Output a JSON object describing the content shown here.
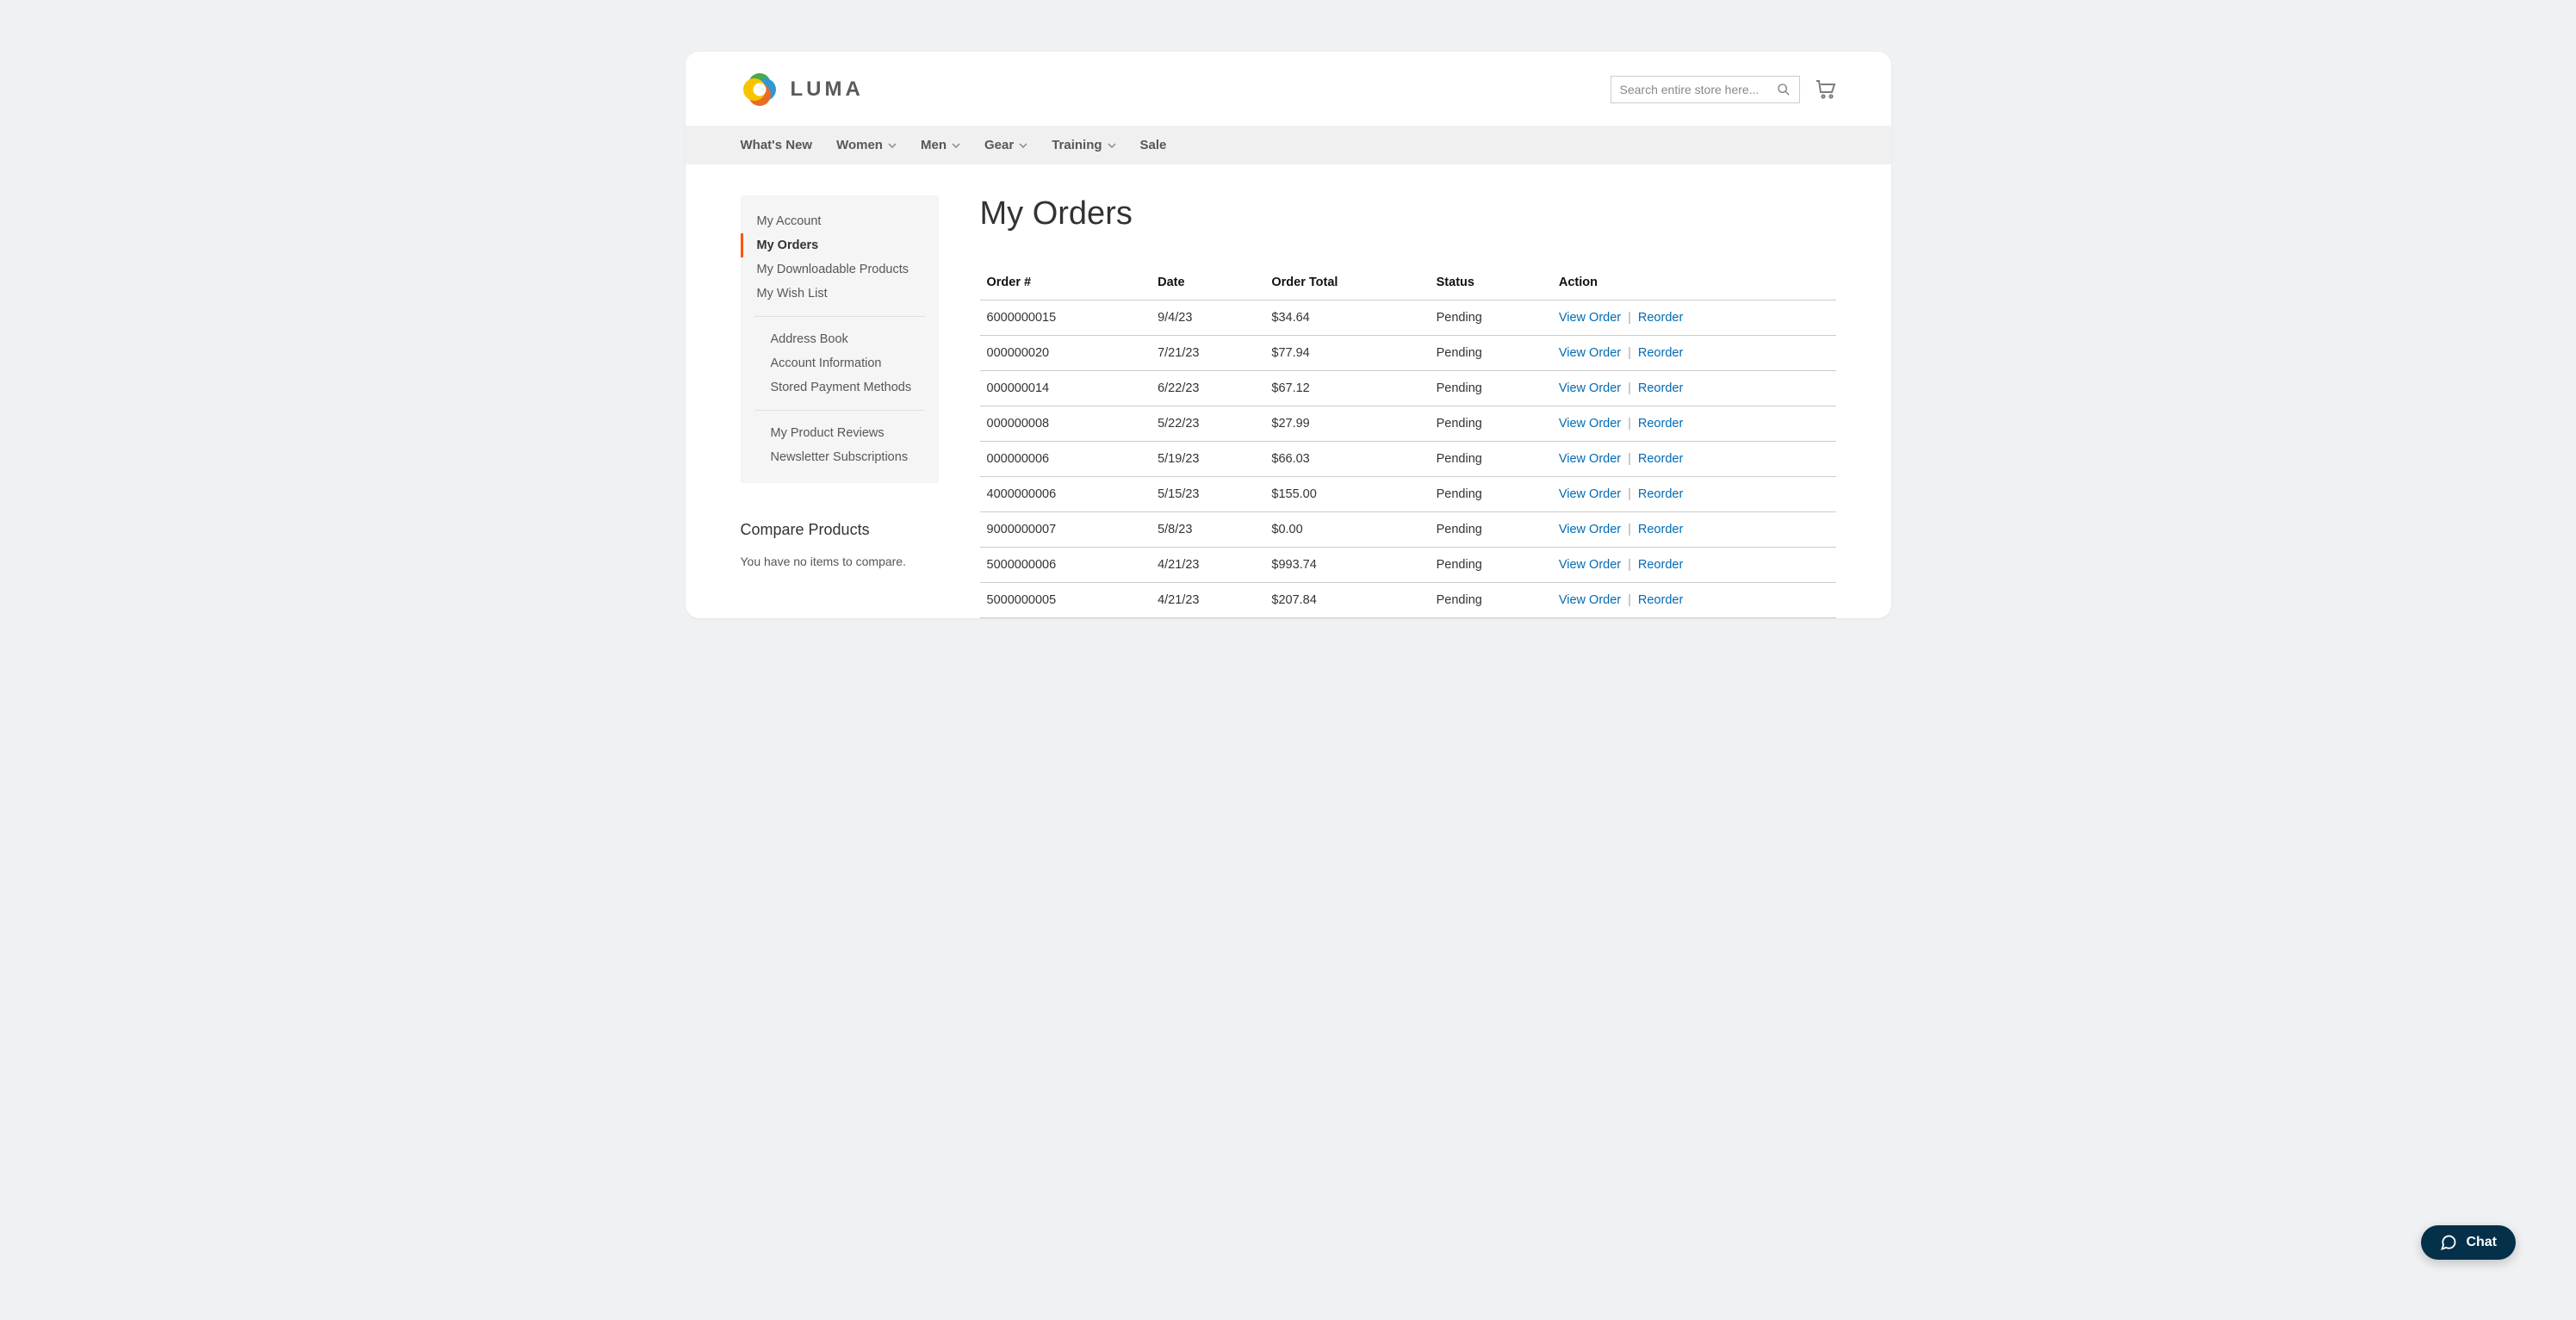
{
  "brand": {
    "name": "LUMA"
  },
  "header": {
    "search_placeholder": "Search entire store here..."
  },
  "nav": {
    "items": [
      {
        "label": "What's New",
        "has_chevron": false
      },
      {
        "label": "Women",
        "has_chevron": true
      },
      {
        "label": "Men",
        "has_chevron": true
      },
      {
        "label": "Gear",
        "has_chevron": true
      },
      {
        "label": "Training",
        "has_chevron": true
      },
      {
        "label": "Sale",
        "has_chevron": false
      }
    ]
  },
  "sidebar": {
    "groups": [
      [
        {
          "label": "My Account",
          "active": false
        },
        {
          "label": "My Orders",
          "active": true
        },
        {
          "label": "My Downloadable Products",
          "active": false
        },
        {
          "label": "My Wish List",
          "active": false
        }
      ],
      [
        {
          "label": "Address Book",
          "active": false
        },
        {
          "label": "Account Information",
          "active": false
        },
        {
          "label": "Stored Payment Methods",
          "active": false
        }
      ],
      [
        {
          "label": "My Product Reviews",
          "active": false
        },
        {
          "label": "Newsletter Subscriptions",
          "active": false
        }
      ]
    ]
  },
  "compare": {
    "title": "Compare Products",
    "empty_text": "You have no items to compare."
  },
  "page": {
    "title": "My Orders"
  },
  "orders": {
    "columns": [
      "Order #",
      "Date",
      "Order Total",
      "Status",
      "Action"
    ],
    "view_label": "View Order",
    "reorder_label": "Reorder",
    "rows": [
      {
        "order_no": "6000000015",
        "date": "9/4/23",
        "total": "$34.64",
        "status": "Pending"
      },
      {
        "order_no": "000000020",
        "date": "7/21/23",
        "total": "$77.94",
        "status": "Pending"
      },
      {
        "order_no": "000000014",
        "date": "6/22/23",
        "total": "$67.12",
        "status": "Pending"
      },
      {
        "order_no": "000000008",
        "date": "5/22/23",
        "total": "$27.99",
        "status": "Pending"
      },
      {
        "order_no": "000000006",
        "date": "5/19/23",
        "total": "$66.03",
        "status": "Pending"
      },
      {
        "order_no": "4000000006",
        "date": "5/15/23",
        "total": "$155.00",
        "status": "Pending"
      },
      {
        "order_no": "9000000007",
        "date": "5/8/23",
        "total": "$0.00",
        "status": "Pending"
      },
      {
        "order_no": "5000000006",
        "date": "4/21/23",
        "total": "$993.74",
        "status": "Pending"
      },
      {
        "order_no": "5000000005",
        "date": "4/21/23",
        "total": "$207.84",
        "status": "Pending"
      }
    ]
  },
  "chat": {
    "label": "Chat"
  }
}
